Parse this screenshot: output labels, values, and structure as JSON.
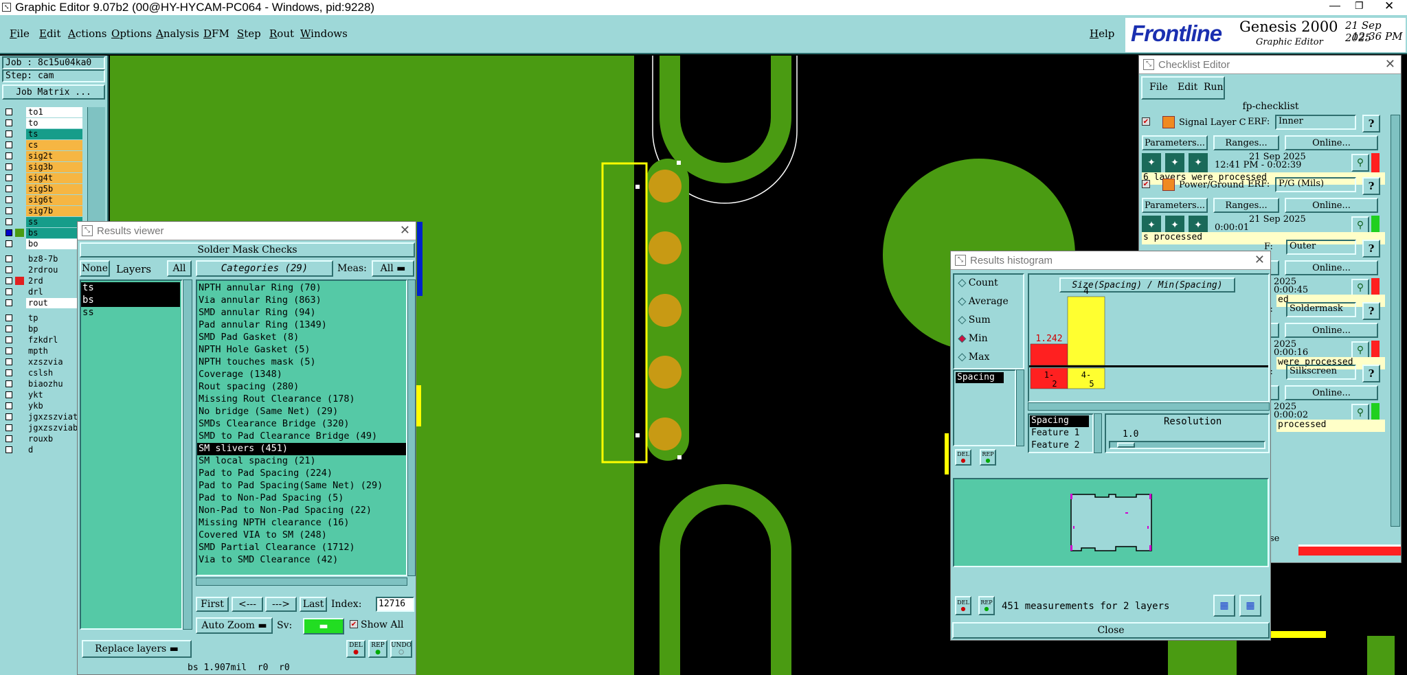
{
  "window": {
    "title": "Graphic Editor 9.07b2 (00@HY-HYCAM-PC064 - Windows, pid:9228)"
  },
  "menu": {
    "items": [
      "File",
      "Edit",
      "Actions",
      "Options",
      "Analysis",
      "DFM",
      "Step",
      "Rout",
      "Windows"
    ],
    "help": "Help"
  },
  "brand": {
    "logo": "Frontline",
    "product": "Genesis 2000",
    "subtitle": "Graphic Editor",
    "date": "21 Sep 2025",
    "time": "12:36 PM"
  },
  "job": {
    "job_label": "Job : 8c15u04ka0",
    "step_label": "Step: cam",
    "matrix_button": "Job Matrix ..."
  },
  "layers": [
    {
      "name": "to1",
      "color": "#ffffff",
      "checked": false,
      "swatch": ""
    },
    {
      "name": "to",
      "color": "#ffffff",
      "checked": false,
      "swatch": ""
    },
    {
      "name": "ts",
      "color": "#169d8a",
      "checked": false,
      "swatch": ""
    },
    {
      "name": "cs",
      "color": "#f6b643",
      "checked": false,
      "swatch": ""
    },
    {
      "name": "sig2t",
      "color": "#f6b643",
      "checked": false,
      "swatch": ""
    },
    {
      "name": "sig3b",
      "color": "#f6b643",
      "checked": false,
      "swatch": ""
    },
    {
      "name": "sig4t",
      "color": "#f6b643",
      "checked": false,
      "swatch": ""
    },
    {
      "name": "sig5b",
      "color": "#f6b643",
      "checked": false,
      "swatch": ""
    },
    {
      "name": "sig6t",
      "color": "#f6b643",
      "checked": false,
      "swatch": ""
    },
    {
      "name": "sig7b",
      "color": "#f6b643",
      "checked": false,
      "swatch": ""
    },
    {
      "name": "ss",
      "color": "#169d8a",
      "checked": false,
      "swatch": ""
    },
    {
      "name": "bs",
      "color": "#169d8a",
      "checked": true,
      "swatch": "#4a9b12"
    },
    {
      "name": "bo",
      "color": "#ffffff",
      "checked": false,
      "swatch": ""
    },
    {
      "name": "bz8-7b",
      "color": "#9ed8d8",
      "checked": false,
      "swatch": ""
    },
    {
      "name": "2rdrou",
      "color": "#9ed8d8",
      "checked": false,
      "swatch": ""
    },
    {
      "name": "2rd",
      "color": "#9ed8d8",
      "checked": false,
      "swatch": "#e02020"
    },
    {
      "name": "drl",
      "color": "#9ed8d8",
      "checked": false,
      "swatch": ""
    },
    {
      "name": "rout",
      "color": "#ffffff",
      "checked": false,
      "swatch": ""
    },
    {
      "name": "tp",
      "color": "#9ed8d8",
      "checked": false,
      "swatch": ""
    },
    {
      "name": "bp",
      "color": "#9ed8d8",
      "checked": false,
      "swatch": ""
    },
    {
      "name": "fzkdrl",
      "color": "#9ed8d8",
      "checked": false,
      "swatch": ""
    },
    {
      "name": "mpth",
      "color": "#9ed8d8",
      "checked": false,
      "swatch": ""
    },
    {
      "name": "xzszvia",
      "color": "#9ed8d8",
      "checked": false,
      "swatch": ""
    },
    {
      "name": "cslsh",
      "color": "#9ed8d8",
      "checked": false,
      "swatch": ""
    },
    {
      "name": "biaozhu",
      "color": "#9ed8d8",
      "checked": false,
      "swatch": ""
    },
    {
      "name": "ykt",
      "color": "#9ed8d8",
      "checked": false,
      "swatch": ""
    },
    {
      "name": "ykb",
      "color": "#9ed8d8",
      "checked": false,
      "swatch": ""
    },
    {
      "name": "jgxzszviat",
      "color": "#9ed8d8",
      "checked": false,
      "swatch": ""
    },
    {
      "name": "jgxzszviab",
      "color": "#9ed8d8",
      "checked": false,
      "swatch": ""
    },
    {
      "name": "rouxb",
      "color": "#9ed8d8",
      "checked": false,
      "swatch": ""
    },
    {
      "name": "d",
      "color": "#9ed8d8",
      "checked": false,
      "swatch": ""
    }
  ],
  "results_viewer": {
    "title": "Results viewer",
    "header": "Solder Mask Checks",
    "none_btn": "None",
    "layers_label": "Layers",
    "all_btn": "All",
    "categories_label": "Categories (29)",
    "meas_label": "Meas:",
    "meas_value": "All",
    "layers_list": [
      "ts",
      "bs",
      "ss"
    ],
    "categories": [
      "NPTH annular Ring (70)",
      "Via annular Ring (863)",
      "SMD annular Ring (94)",
      "Pad annular Ring (1349)",
      "SMD Pad Gasket (8)",
      "NPTH Hole Gasket (5)",
      "NPTH touches mask (5)",
      "Coverage (1348)",
      "Rout spacing (280)",
      "Missing Rout Clearance (178)",
      "No bridge (Same Net) (29)",
      "SMDs Clearance Bridge (320)",
      "SMD to Pad Clearance Bridge (49)",
      "SM slivers (451)",
      "SM local spacing (21)",
      "Pad to Pad Spacing (224)",
      "Pad to Pad Spacing(Same Net) (29)",
      "Pad to Non-Pad Spacing (5)",
      "Non-Pad to Non-Pad Spacing (22)",
      "Missing NPTH clearance (16)",
      "Covered VIA to SM (248)",
      "SMD Partial Clearance (1712)",
      "Via to SMD Clearance (42)"
    ],
    "selected_category": "SM slivers (451)",
    "nav": {
      "first": "First",
      "prev": "<---",
      "next": "--->",
      "last": "Last",
      "index_label": "Index:",
      "index_value": "12716"
    },
    "auto_zoom": "Auto Zoom",
    "sv_label": "Sv:",
    "show_all": "Show All",
    "replace_layers": "Replace layers",
    "small_btns": [
      "DEL",
      "REP",
      "UNDO"
    ],
    "status": "bs 1.907mil  r0  r0"
  },
  "histogram": {
    "title": "Results histogram",
    "options": [
      "Count",
      "Average",
      "Sum",
      "Min",
      "Max"
    ],
    "selected_option": "Min",
    "list_item": "Spacing",
    "chart_title": "Size(Spacing) / Min(Spacing)",
    "chart_data": {
      "type": "bar",
      "categories": [
        "1-2",
        "4-5"
      ],
      "values": [
        1.242,
        4
      ],
      "colors": [
        "#ff2020",
        "#ffff30"
      ]
    },
    "fields": [
      "Spacing",
      "Feature 1",
      "Feature 2"
    ],
    "resolution_label": "Resolution",
    "resolution_value": "1.0",
    "measurements": "451 measurements for 2 layers",
    "close": "Close",
    "small_btns": [
      "DEL",
      "REP"
    ]
  },
  "checklist": {
    "title": "Checklist Editor",
    "menu": [
      "File",
      "Edit",
      "Run"
    ],
    "name": "fp-checklist",
    "items": [
      {
        "label": "Signal Layer Ch",
        "erf": "ERF:",
        "erf_value": "Inner",
        "date": "21 Sep 2025",
        "time": "12:41 PM - 0:02:39",
        "status": "6 layers were processed",
        "status_color": "#ff2020"
      },
      {
        "label": "Power/Ground C",
        "erf": "ERF:",
        "erf_value": "P/G (Mils)",
        "date": "21 Sep 2025",
        "time": "0:00:01",
        "status": "s processed",
        "status_color": "#20d020"
      },
      {
        "label": "",
        "erf": "F:",
        "erf_value": "Outer",
        "date": "2025",
        "time": "0:00:45",
        "status": "ed",
        "status_color": "#ff2020"
      },
      {
        "label": "",
        "erf": "F:",
        "erf_value": "Soldermask",
        "date": "2025",
        "time": "0:00:16",
        "status": "were processed",
        "status_color": "#ff2020"
      },
      {
        "label": "",
        "erf": "F:",
        "erf_value": "Silkscreen",
        "date": "2025",
        "time": "0:00:02",
        "status": "processed",
        "status_color": "#20d020"
      }
    ],
    "btns": {
      "params": "Parameters...",
      "ranges": "Ranges...",
      "online": "Online..."
    },
    "footer": "se"
  }
}
